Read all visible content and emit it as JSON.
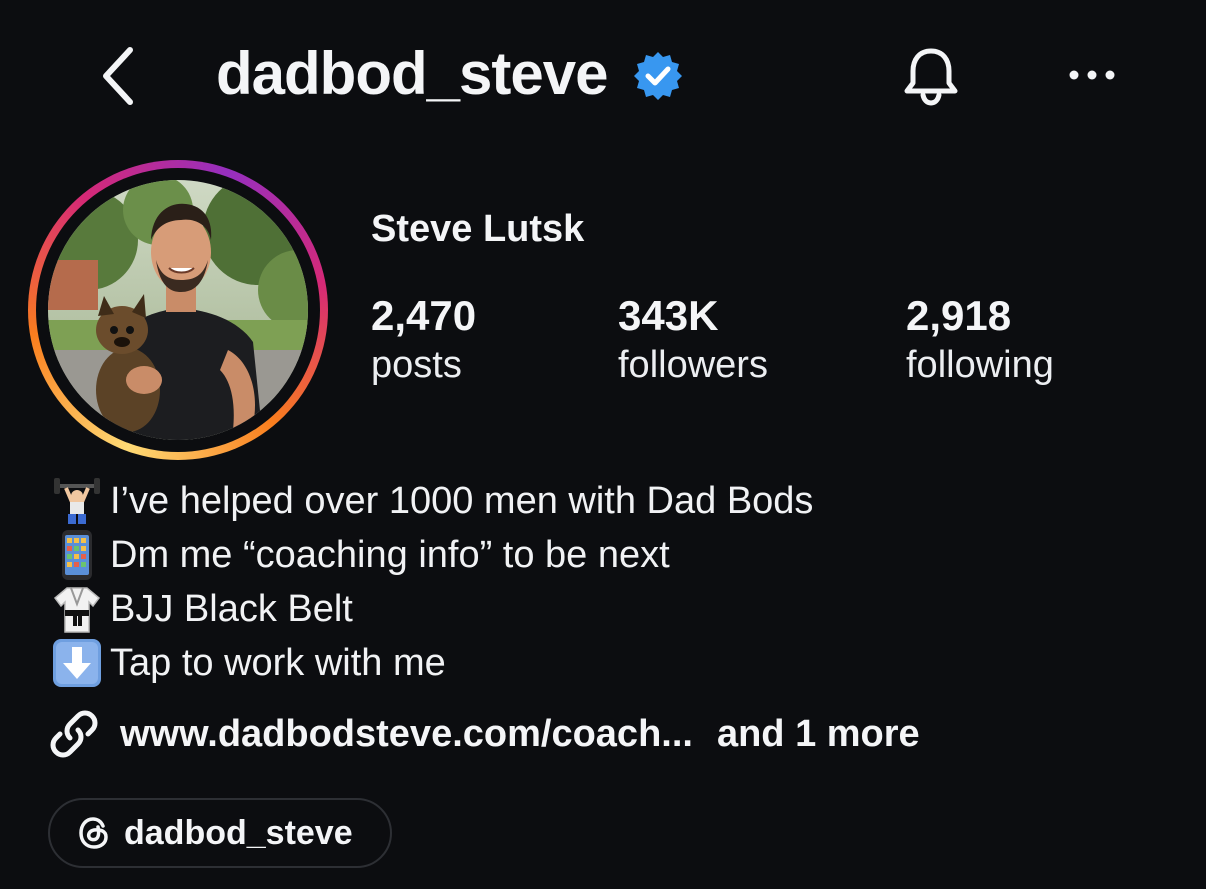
{
  "header": {
    "username": "dadbod_steve",
    "back_icon": "chevron-left-icon",
    "verified_icon": "verified-badge-icon",
    "notification_icon": "bell-icon",
    "more_icon": "more-horizontal-icon"
  },
  "profile": {
    "display_name": "Steve Lutsk",
    "avatar_icon": "profile-photo"
  },
  "stats": [
    {
      "count": "2,470",
      "label": "posts"
    },
    {
      "count": "343K",
      "label": "followers"
    },
    {
      "count": "2,918",
      "label": "following"
    }
  ],
  "bio": [
    {
      "emoji": "weightlifter-emoji",
      "text": "I’ve helped over 1000 men with Dad Bods"
    },
    {
      "emoji": "mobile-phone-emoji",
      "text": "Dm me “coaching info” to be next"
    },
    {
      "emoji": "martial-arts-uniform-emoji",
      "text": "BJJ Black Belt"
    },
    {
      "emoji": "down-arrow-emoji",
      "text": "Tap to work with me"
    }
  ],
  "link": {
    "icon": "link-icon",
    "url_text": "www.dadbodsteve.com/coach...",
    "more_text": "and 1 more"
  },
  "threads": {
    "icon": "threads-icon",
    "label": "dadbod_steve"
  },
  "colors": {
    "background": "#0c0d10",
    "text": "#f4f5f7",
    "verified": "#3897f0",
    "pill_border": "#2d2f34"
  }
}
